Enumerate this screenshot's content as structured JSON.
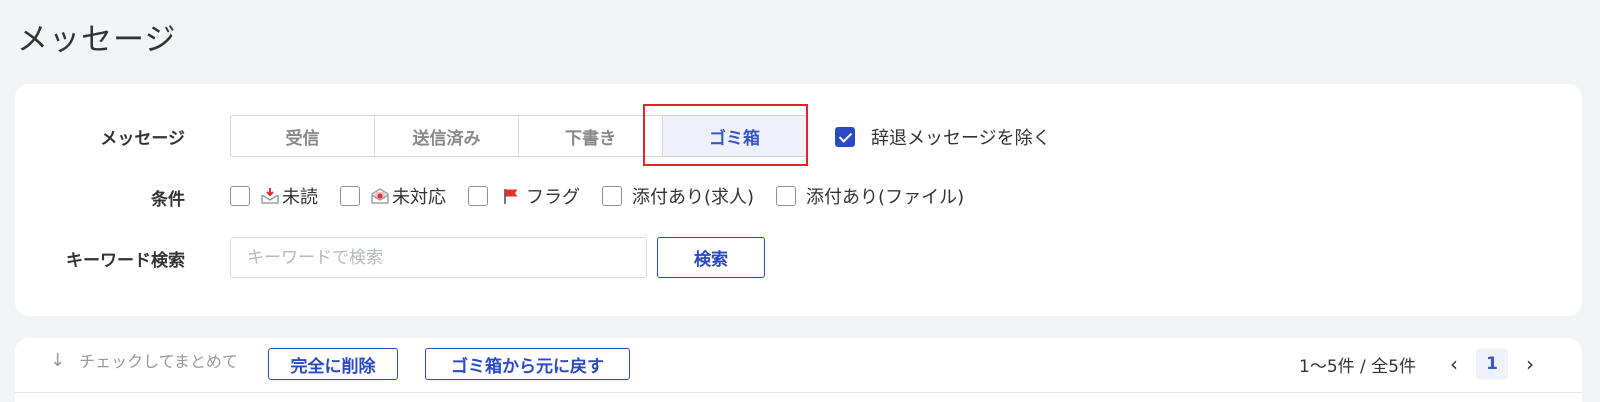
{
  "page": {
    "title": "メッセージ"
  },
  "filters": {
    "message_label": "メッセージ",
    "tabs": [
      {
        "label": "受信",
        "active": false
      },
      {
        "label": "送信済み",
        "active": false
      },
      {
        "label": "下書き",
        "active": false
      },
      {
        "label": "ゴミ箱",
        "active": true
      }
    ],
    "exclude_declined": {
      "label": "辞退メッセージを除く",
      "checked": true
    },
    "conditions_label": "条件",
    "conditions": [
      {
        "label": "未読",
        "icon": "unread-inbox-icon",
        "checked": false
      },
      {
        "label": "未対応",
        "icon": "open-envelope-icon",
        "checked": false
      },
      {
        "label": "フラグ",
        "icon": "red-flag-icon",
        "checked": false
      },
      {
        "label": "添付あり(求人)",
        "icon": "",
        "checked": false
      },
      {
        "label": "添付あり(ファイル)",
        "icon": "",
        "checked": false
      }
    ],
    "keyword_label": "キーワード検索",
    "keyword_placeholder": "キーワードで検索",
    "keyword_value": "",
    "search_button": "検索"
  },
  "bulk": {
    "hint": "チェックしてまとめて",
    "delete_button": "完全に削除",
    "restore_button": "ゴミ箱から元に戻す"
  },
  "pagination": {
    "range": "1〜5件 / 全5件",
    "current_page": "1",
    "prev_icon": "chevron-left-icon",
    "next_icon": "chevron-right-icon"
  },
  "colors": {
    "accent": "#2a49c2",
    "active_tab_bg": "#eef1fb",
    "highlight_border": "#e3242b",
    "flag": "#e0312b"
  }
}
